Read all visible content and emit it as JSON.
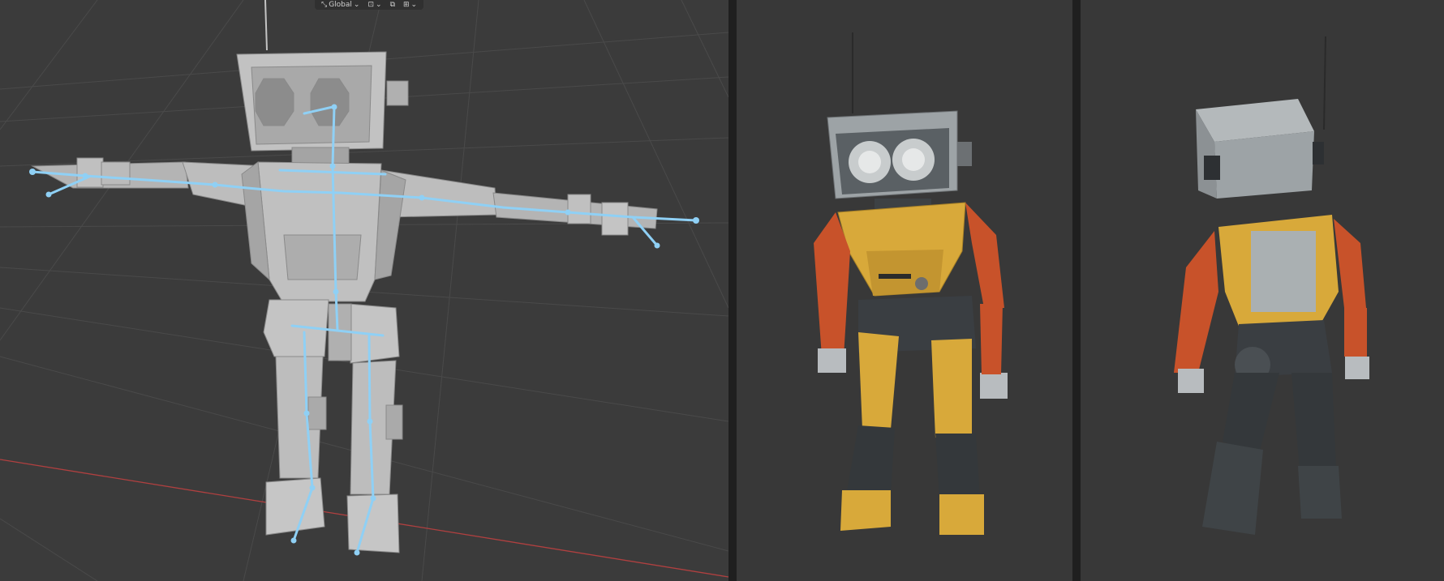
{
  "viewport_header": {
    "transform_orientation": "Global",
    "icons": [
      "orientation-icon",
      "pivot-icon",
      "snap-icon",
      "proportional-edit-icon"
    ]
  },
  "colors": {
    "bone": "#8fd0f5",
    "mesh": "#b9b9b9",
    "grid": "#4a4a4a",
    "x_axis": "#b04040",
    "robot_yellow": "#d8a93a",
    "robot_orange": "#c8522a",
    "robot_dark": "#3a3e42",
    "robot_gray": "#9aa0a3"
  }
}
